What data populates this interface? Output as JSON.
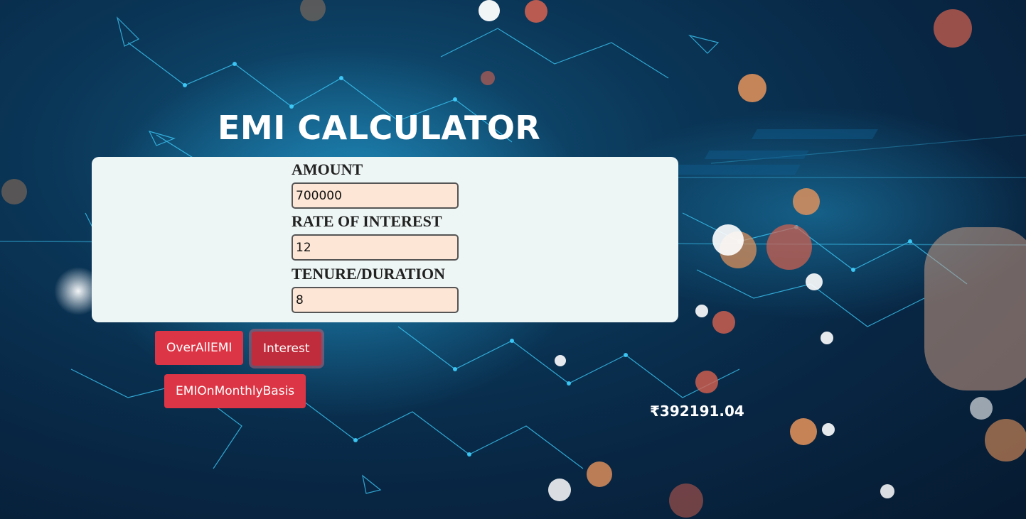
{
  "header": {
    "title": "EMI CALCULATOR"
  },
  "form": {
    "amount": {
      "label": "AMOUNT",
      "value": "700000"
    },
    "rate": {
      "label": "RATE OF INTEREST",
      "value": "12"
    },
    "tenure": {
      "label": "TENURE/DURATION",
      "value": "8"
    }
  },
  "buttons": {
    "overall_emi": "OverAllEMI",
    "interest": "Interest",
    "emi_monthly": "EMIOnMonthlyBasis"
  },
  "result": {
    "value": "₹392191.04"
  },
  "colors": {
    "button": "#dc3545",
    "card": "#eef6f5",
    "input": "#fde6d6",
    "background": "#0a3556"
  }
}
